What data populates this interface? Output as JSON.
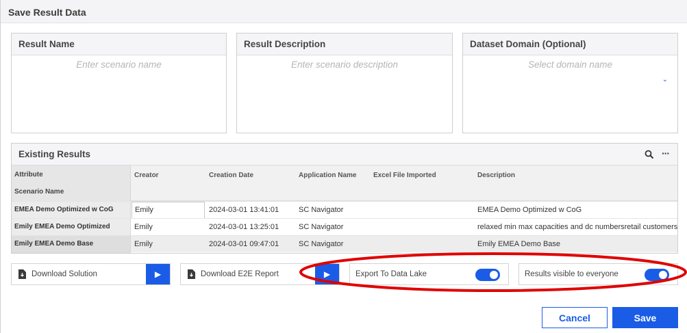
{
  "dialog": {
    "title": "Save Result Data"
  },
  "fields": {
    "result_name": {
      "label": "Result Name",
      "placeholder": "Enter scenario name"
    },
    "result_description": {
      "label": "Result Description",
      "placeholder": "Enter scenario description"
    },
    "dataset_domain": {
      "label": "Dataset Domain (Optional)",
      "placeholder": "Select domain name"
    }
  },
  "existing_results": {
    "title": "Existing Results",
    "attribute_header": "Attribute",
    "scenario_name_header": "Scenario Name",
    "columns": [
      "Creator",
      "Creation Date",
      "Application Name",
      "Excel File Imported",
      "Description"
    ],
    "rows": [
      {
        "scenario": "EMEA Demo Optimized w CoG",
        "creator": "Emily",
        "date": "2024-03-01 13:41:01",
        "app": "SC Navigator",
        "excel": "",
        "description": "EMEA Demo Optimized w CoG"
      },
      {
        "scenario": "Emily EMEA Demo Optimized",
        "creator": "Emily",
        "date": "2024-03-01 13:25:01",
        "app": "SC Navigator",
        "excel": "",
        "description": "relaxed min max capacities and dc numbersretail customers"
      },
      {
        "scenario": "Emily EMEA Demo Base",
        "creator": "Emily",
        "date": "2024-03-01 09:47:01",
        "app": "SC Navigator",
        "excel": "",
        "description": "Emily EMEA Demo Base"
      }
    ]
  },
  "actions": {
    "download_solution": "Download Solution",
    "download_e2e": "Download E2E Report",
    "export_data_lake": {
      "label": "Export To Data Lake",
      "on": true
    },
    "results_visible": {
      "label": "Results visible to everyone",
      "on": true
    }
  },
  "buttons": {
    "cancel": "Cancel",
    "save": "Save"
  },
  "colors": {
    "accent": "#1a5ce6",
    "highlight": "#e00000"
  }
}
